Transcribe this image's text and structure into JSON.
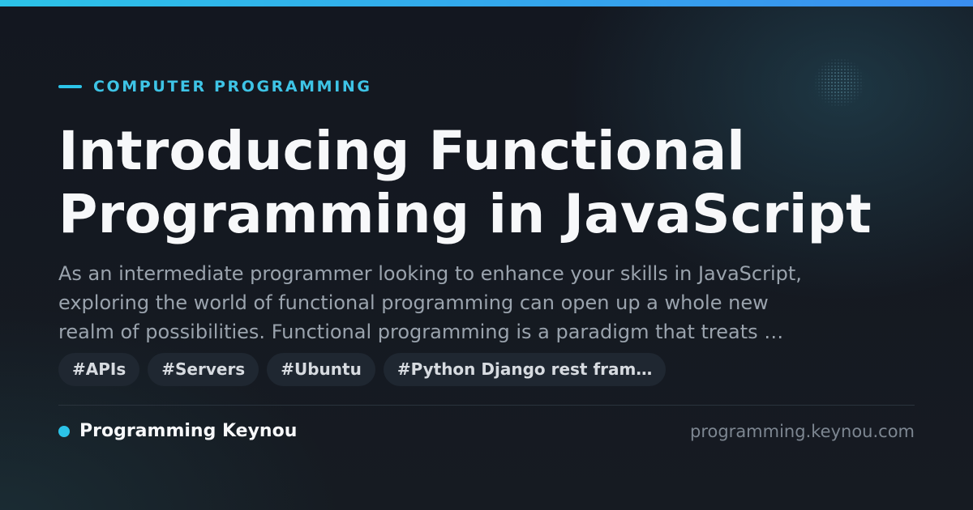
{
  "category": "COMPUTER PROGRAMMING",
  "title": {
    "lines": [
      "Introducing Functional",
      "Programming in JavaScript"
    ]
  },
  "description": {
    "lines": [
      "As an intermediate programmer looking to enhance your skills in JavaScript,",
      "exploring the world of functional programming can open up a whole new",
      "realm of possibilities. Functional programming is a paradigm that treats …"
    ]
  },
  "tags": [
    "#APIs",
    "#Servers",
    "#Ubuntu",
    "#Python Django rest fram…"
  ],
  "brand": {
    "name": "Programming Keynou",
    "url": "programming.keynou.com"
  },
  "colors": {
    "accent": "#2cc3e8",
    "accent_end": "#3a8ef0",
    "background": "#141820",
    "title": "#f7f8fa",
    "description": "#9aa3ad",
    "tag_background": "#1f2731"
  }
}
